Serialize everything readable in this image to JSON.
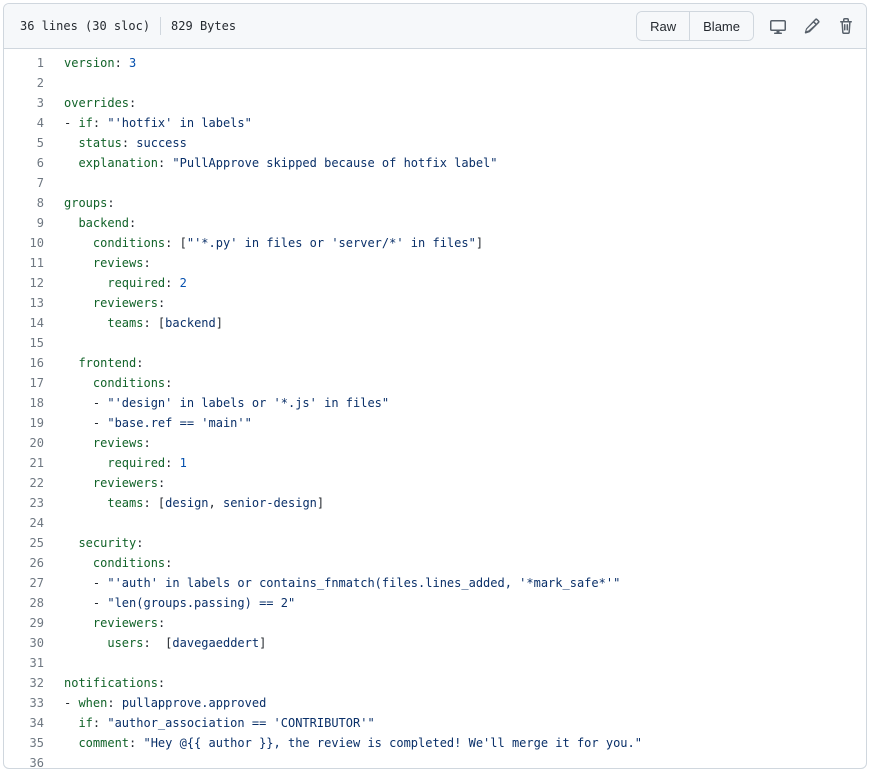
{
  "file_info": {
    "lines": "36 lines (30 sloc)",
    "size": "829 Bytes"
  },
  "actions": {
    "raw_label": "Raw",
    "blame_label": "Blame",
    "icons": [
      "desktop-icon",
      "pencil-icon",
      "trash-icon"
    ]
  },
  "colors": {
    "key": "#116329",
    "number": "#0550ae",
    "string": "#0a3069",
    "line_number": "#6e7781"
  },
  "lines": [
    [
      [
        "k",
        "version"
      ],
      [
        "t",
        ": "
      ],
      [
        "n",
        "3"
      ]
    ],
    [],
    [
      [
        "k",
        "overrides"
      ],
      [
        "t",
        ":"
      ]
    ],
    [
      [
        "t",
        "- "
      ],
      [
        "k",
        "if"
      ],
      [
        "t",
        ": "
      ],
      [
        "s",
        "\"'hotfix' in labels\""
      ]
    ],
    [
      [
        "t",
        "  "
      ],
      [
        "k",
        "status"
      ],
      [
        "t",
        ": "
      ],
      [
        "s",
        "success"
      ]
    ],
    [
      [
        "t",
        "  "
      ],
      [
        "k",
        "explanation"
      ],
      [
        "t",
        ": "
      ],
      [
        "s",
        "\"PullApprove skipped because of hotfix label\""
      ]
    ],
    [],
    [
      [
        "k",
        "groups"
      ],
      [
        "t",
        ":"
      ]
    ],
    [
      [
        "t",
        "  "
      ],
      [
        "k",
        "backend"
      ],
      [
        "t",
        ":"
      ]
    ],
    [
      [
        "t",
        "    "
      ],
      [
        "k",
        "conditions"
      ],
      [
        "t",
        ": ["
      ],
      [
        "s",
        "\"'*.py' in files or 'server/*' in files\""
      ],
      [
        "t",
        "]"
      ]
    ],
    [
      [
        "t",
        "    "
      ],
      [
        "k",
        "reviews"
      ],
      [
        "t",
        ":"
      ]
    ],
    [
      [
        "t",
        "      "
      ],
      [
        "k",
        "required"
      ],
      [
        "t",
        ": "
      ],
      [
        "n",
        "2"
      ]
    ],
    [
      [
        "t",
        "    "
      ],
      [
        "k",
        "reviewers"
      ],
      [
        "t",
        ":"
      ]
    ],
    [
      [
        "t",
        "      "
      ],
      [
        "k",
        "teams"
      ],
      [
        "t",
        ": ["
      ],
      [
        "s",
        "backend"
      ],
      [
        "t",
        "]"
      ]
    ],
    [],
    [
      [
        "t",
        "  "
      ],
      [
        "k",
        "frontend"
      ],
      [
        "t",
        ":"
      ]
    ],
    [
      [
        "t",
        "    "
      ],
      [
        "k",
        "conditions"
      ],
      [
        "t",
        ":"
      ]
    ],
    [
      [
        "t",
        "    - "
      ],
      [
        "s",
        "\"'design' in labels or '*.js' in files\""
      ]
    ],
    [
      [
        "t",
        "    - "
      ],
      [
        "s",
        "\"base.ref == 'main'\""
      ]
    ],
    [
      [
        "t",
        "    "
      ],
      [
        "k",
        "reviews"
      ],
      [
        "t",
        ":"
      ]
    ],
    [
      [
        "t",
        "      "
      ],
      [
        "k",
        "required"
      ],
      [
        "t",
        ": "
      ],
      [
        "n",
        "1"
      ]
    ],
    [
      [
        "t",
        "    "
      ],
      [
        "k",
        "reviewers"
      ],
      [
        "t",
        ":"
      ]
    ],
    [
      [
        "t",
        "      "
      ],
      [
        "k",
        "teams"
      ],
      [
        "t",
        ": ["
      ],
      [
        "s",
        "design"
      ],
      [
        "t",
        ", "
      ],
      [
        "s",
        "senior-design"
      ],
      [
        "t",
        "]"
      ]
    ],
    [],
    [
      [
        "t",
        "  "
      ],
      [
        "k",
        "security"
      ],
      [
        "t",
        ":"
      ]
    ],
    [
      [
        "t",
        "    "
      ],
      [
        "k",
        "conditions"
      ],
      [
        "t",
        ":"
      ]
    ],
    [
      [
        "t",
        "    - "
      ],
      [
        "s",
        "\"'auth' in labels or contains_fnmatch(files.lines_added, '*mark_safe*'\""
      ]
    ],
    [
      [
        "t",
        "    - "
      ],
      [
        "s",
        "\"len(groups.passing) == 2\""
      ]
    ],
    [
      [
        "t",
        "    "
      ],
      [
        "k",
        "reviewers"
      ],
      [
        "t",
        ":"
      ]
    ],
    [
      [
        "t",
        "      "
      ],
      [
        "k",
        "users"
      ],
      [
        "t",
        ":  ["
      ],
      [
        "s",
        "davegaeddert"
      ],
      [
        "t",
        "]"
      ]
    ],
    [],
    [
      [
        "k",
        "notifications"
      ],
      [
        "t",
        ":"
      ]
    ],
    [
      [
        "t",
        "- "
      ],
      [
        "k",
        "when"
      ],
      [
        "t",
        ": "
      ],
      [
        "s",
        "pullapprove.approved"
      ]
    ],
    [
      [
        "t",
        "  "
      ],
      [
        "k",
        "if"
      ],
      [
        "t",
        ": "
      ],
      [
        "s",
        "\"author_association == 'CONTRIBUTOR'\""
      ]
    ],
    [
      [
        "t",
        "  "
      ],
      [
        "k",
        "comment"
      ],
      [
        "t",
        ": "
      ],
      [
        "s",
        "\"Hey @{{ author }}, the review is completed! We'll merge it for you.\""
      ]
    ],
    []
  ]
}
